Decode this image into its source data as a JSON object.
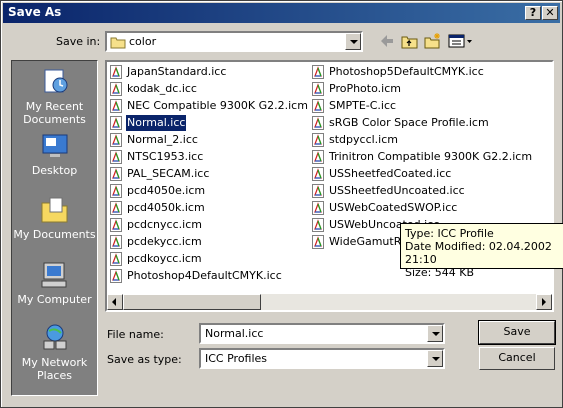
{
  "window": {
    "title": "Save As",
    "help_label": "?",
    "close_label": "✕"
  },
  "toolbar": {
    "save_in_label": "Save in:",
    "save_in_value": "color",
    "icons": [
      "back-arrow-icon",
      "up-folder-icon",
      "new-folder-icon",
      "view-menu-icon"
    ]
  },
  "places": [
    {
      "label": "My Recent Documents",
      "icon": "recent-documents-icon"
    },
    {
      "label": "Desktop",
      "icon": "desktop-icon"
    },
    {
      "label": "My Documents",
      "icon": "my-documents-icon"
    },
    {
      "label": "My Computer",
      "icon": "my-computer-icon"
    },
    {
      "label": "My Network Places",
      "icon": "network-places-icon"
    }
  ],
  "files": {
    "column1": [
      "JapanStandard.icc",
      "kodak_dc.icc",
      "NEC Compatible 9300K G2.2.icm",
      "Normal.icc",
      "Normal_2.icc",
      "NTSC1953.icc",
      "PAL_SECAM.icc",
      "pcd4050e.icm",
      "pcd4050k.icm",
      "pcdcnycc.icm",
      "pcdekycc.icm",
      "pcdkoycc.icm",
      "Photoshop4DefaultCMYK.icc"
    ],
    "column2": [
      "Photoshop5DefaultCMYK.icc",
      "ProPhoto.icm",
      "SMPTE-C.icc",
      "sRGB Color Space Profile.icm",
      "stdpyccl.icm",
      "Trinitron Compatible 9300K G2.2.icm",
      "USSheetfedCoated.icc",
      "USSheetfedUncoated.icc",
      "USWebCoatedSWOP.icc",
      "USWebUncoated.icc",
      "WideGamutRGB.icc"
    ],
    "selected": "Normal.icc"
  },
  "tooltip": {
    "type": "Type: ICC Profile",
    "modified": "Date Modified: 02.04.2002 21:10",
    "size": "Size: 544 KB"
  },
  "form": {
    "file_name_label": "File name:",
    "file_name_value": "Normal.icc",
    "save_as_type_label": "Save as type:",
    "save_as_type_value": "ICC Profiles"
  },
  "buttons": {
    "save": "Save",
    "cancel": "Cancel"
  },
  "colors": {
    "title_start": "#0a246a",
    "title_end": "#3a6ea5",
    "dialog": "#d4d0c8",
    "selection": "#0a246a",
    "places_bg": "#808080",
    "tooltip_bg": "#ffffe1"
  }
}
